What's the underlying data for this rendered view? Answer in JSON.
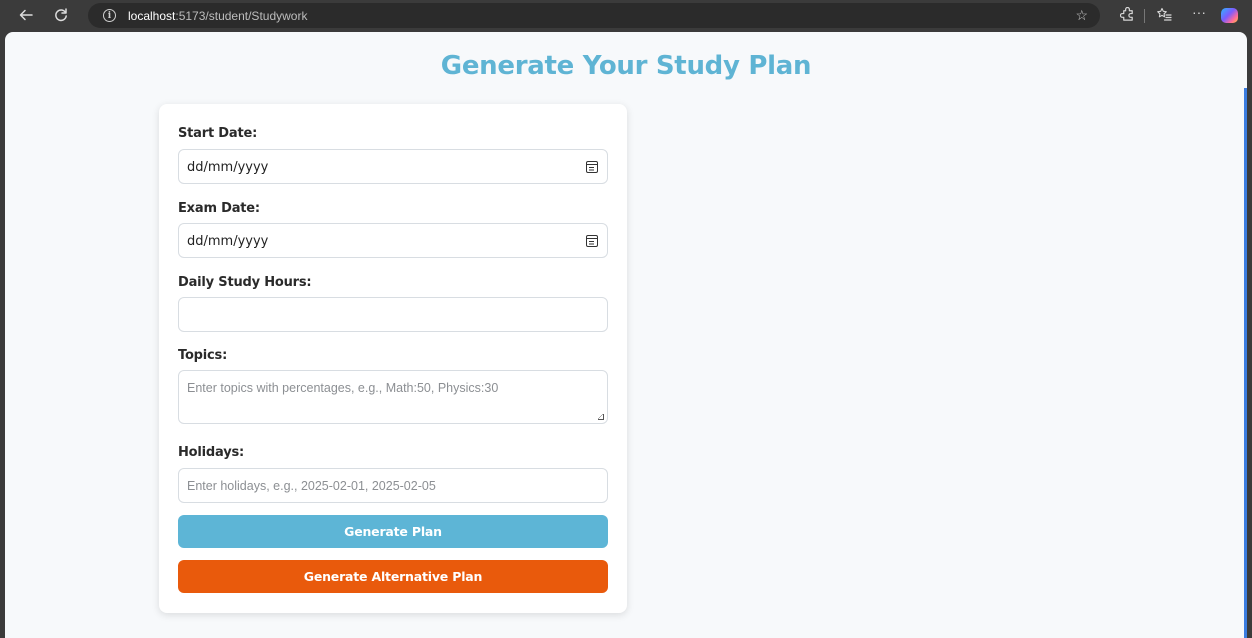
{
  "browser": {
    "url_host": "localhost",
    "url_path": ":5173/student/Studywork",
    "icons": [
      "back-arrow-icon",
      "reload-icon",
      "info-icon",
      "star-icon",
      "extensions-icon",
      "favorites-icon",
      "more-icon",
      "copilot-icon"
    ]
  },
  "page": {
    "title": "Generate Your Study Plan"
  },
  "form": {
    "start_date": {
      "label": "Start Date:",
      "value": "dd/mm/yyyy"
    },
    "exam_date": {
      "label": "Exam Date:",
      "value": "dd/mm/yyyy"
    },
    "daily_hours": {
      "label": "Daily Study Hours:",
      "value": ""
    },
    "topics": {
      "label": "Topics:",
      "placeholder": "Enter topics with percentages, e.g., Math:50, Physics:30"
    },
    "holidays": {
      "label": "Holidays:",
      "placeholder": "Enter holidays, e.g., 2025-02-01, 2025-02-05"
    },
    "generate_button": "Generate Plan",
    "alternative_button": "Generate Alternative Plan"
  },
  "colors": {
    "title": "#5fb4d4",
    "primary_button": "#5db5d6",
    "alternative_button": "#e95a0c",
    "background": "#f7f9fb"
  }
}
